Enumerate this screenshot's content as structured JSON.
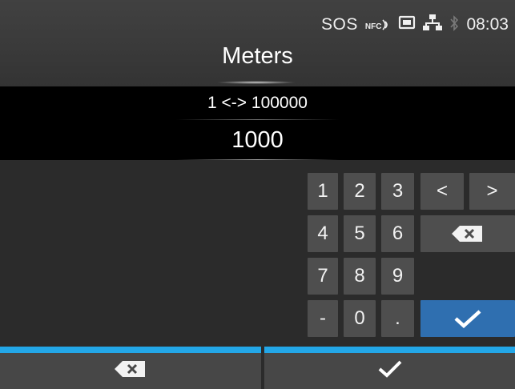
{
  "status": {
    "sos": "SOS",
    "nfc": "NFC",
    "time": "08:03",
    "icons": [
      "nfc-icon",
      "sd-card-icon",
      "network-icon",
      "bluetooth-icon"
    ]
  },
  "title": "Meters",
  "range": "1 <-> 100000",
  "value": "1000",
  "keypad": {
    "rows": [
      [
        "1",
        "2",
        "3",
        "<",
        ">"
      ],
      [
        "4",
        "5",
        "6",
        "backspace"
      ],
      [
        "7",
        "8",
        "9"
      ],
      [
        "-",
        "0",
        ".",
        "confirm"
      ]
    ]
  },
  "bottom": {
    "left": "backspace",
    "right": "confirm"
  },
  "colors": {
    "accent": "#23a7e8",
    "confirm_key": "#2f6fb0",
    "key": "#4e4e4e",
    "background": "#2b2b2b"
  }
}
